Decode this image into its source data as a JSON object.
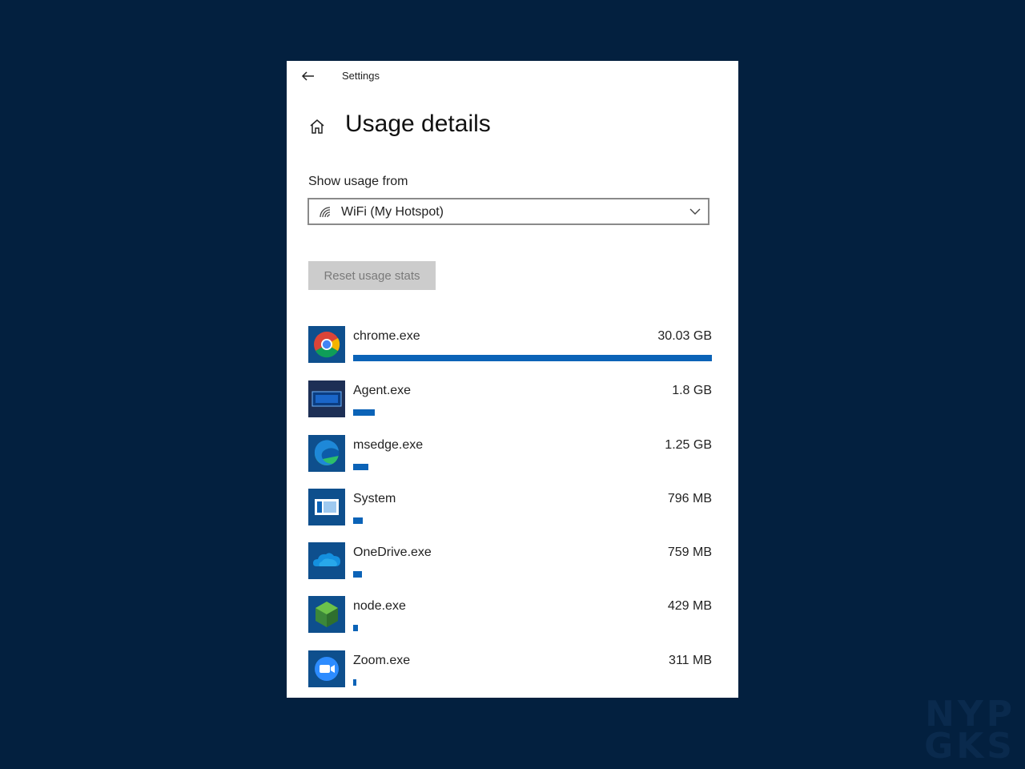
{
  "window": {
    "title": "Settings",
    "page_title": "Usage details"
  },
  "usage": {
    "show_label": "Show usage from",
    "selected_network": "WiFi (My Hotspot)",
    "reset_label": "Reset usage stats"
  },
  "apps": [
    {
      "name": "chrome.exe",
      "size": "30.03 GB",
      "share": 1.0,
      "icon": "chrome-icon"
    },
    {
      "name": "Agent.exe",
      "size": "1.8 GB",
      "share": 0.06,
      "icon": "agent-icon"
    },
    {
      "name": "msedge.exe",
      "size": "1.25 GB",
      "share": 0.042,
      "icon": "edge-icon"
    },
    {
      "name": "System",
      "size": "796 MB",
      "share": 0.026,
      "icon": "system-icon"
    },
    {
      "name": "OneDrive.exe",
      "size": "759 MB",
      "share": 0.025,
      "icon": "onedrive-icon"
    },
    {
      "name": "node.exe",
      "size": "429 MB",
      "share": 0.014,
      "icon": "node-icon"
    },
    {
      "name": "Zoom.exe",
      "size": "311 MB",
      "share": 0.008,
      "icon": "zoom-icon"
    }
  ],
  "colors": {
    "background": "#03203f",
    "accent_bar": "#0b63b7",
    "icon_tile": "#0e4f8d"
  },
  "watermark": {
    "line1": "NYP",
    "line2": "GKS"
  }
}
